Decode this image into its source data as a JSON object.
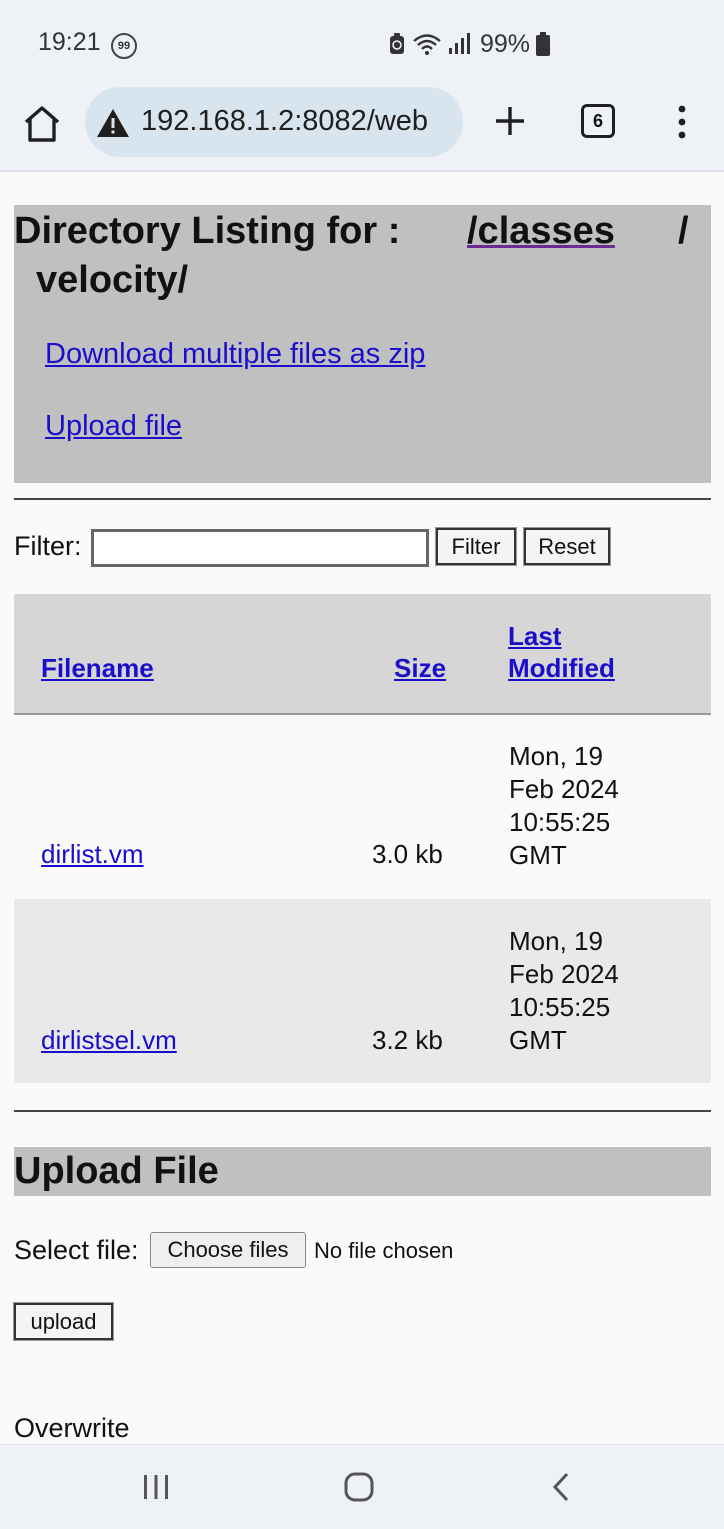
{
  "status_bar": {
    "time": "19:21",
    "notification_count": "99",
    "battery": "99%"
  },
  "browser": {
    "url": "192.168.1.2:8082/web",
    "tab_count": "6"
  },
  "header": {
    "title_prefix": "Directory Listing for :",
    "path_link": "/classes",
    "separator": "/",
    "path_rest": "velocity/",
    "download_zip_link": "Download multiple files as zip",
    "upload_link": "Upload file"
  },
  "filter": {
    "label": "Filter:",
    "input_value": "",
    "filter_button": "Filter",
    "reset_button": "Reset"
  },
  "table": {
    "columns": {
      "filename": "Filename",
      "size": "Size",
      "last_modified_line1": "Last",
      "last_modified_line2": "Modified"
    },
    "rows": [
      {
        "filename": "dirlist.vm",
        "size": "3.0 kb",
        "date_line1": "Mon, 19",
        "date_line2": "Feb 2024",
        "date_line3": "10:55:25",
        "date_line4": "GMT"
      },
      {
        "filename": "dirlistsel.vm",
        "size": "3.2 kb",
        "date_line1": "Mon, 19",
        "date_line2": "Feb 2024",
        "date_line3": "10:55:25",
        "date_line4": "GMT"
      }
    ]
  },
  "upload": {
    "heading": "Upload File",
    "select_label": "Select file:",
    "choose_button": "Choose files",
    "no_file_text": "No file chosen",
    "upload_button": "upload",
    "overwrite_label": "Overwrite"
  }
}
